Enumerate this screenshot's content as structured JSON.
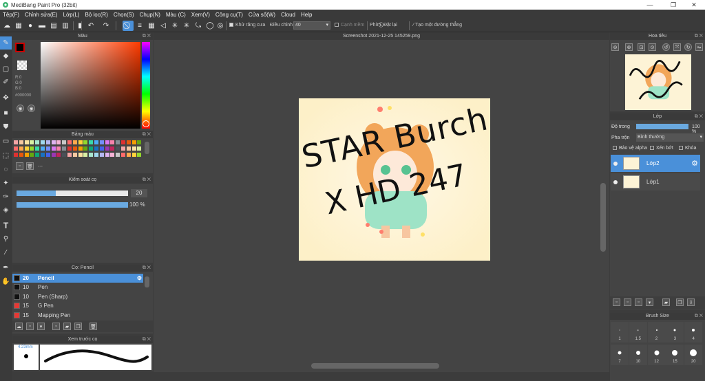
{
  "window": {
    "title": "MediBang Paint Pro (32bit)",
    "minimize": "—",
    "restore": "❐",
    "close": "✕"
  },
  "menu": [
    "Tệp(F)",
    "Chỉnh sửa(E)",
    "Lớp(L)",
    "Bộ lọc(R)",
    "Chọn(S)",
    "Chụp(N)",
    "Màu (C)",
    "Xem(V)",
    "Công cụ(T)",
    "Cửa sổ(W)",
    "Cloud",
    "Help"
  ],
  "toolbar": {
    "antialias_label": "Khử răng cưa",
    "adjust_label": "Điều chỉnh",
    "adjust_value": "40",
    "edge_label": "Cạnh mềm",
    "key_label": "Phím",
    "reset_label": "Đặt lại",
    "straight_line_label": "Tạo một đường thẳng"
  },
  "document": {
    "tab_title": "Screenshot 2021-12-25 145259.png",
    "artwork_text_1": "STAR Burch",
    "artwork_text_2": "X HD 247"
  },
  "color_panel": {
    "title": "Màu",
    "r_label": "R:0",
    "g_label": "G:0",
    "b_label": "B:0",
    "hex": "#000000",
    "primary_color": "#000000",
    "secondary_color": "#ff0000"
  },
  "palette_panel": {
    "title": "Bảng màu",
    "add_label": "---"
  },
  "brush_control_panel": {
    "title": "Kiểm soát cọ",
    "size_value": "20",
    "size_fraction": 0.35,
    "opacity_value": "100 %",
    "opacity_fraction": 1.0
  },
  "brush_panel": {
    "title": "Cọ: Pencil",
    "brushes": [
      {
        "size": "20",
        "name": "Pencil",
        "color": "#111111",
        "selected": true
      },
      {
        "size": "10",
        "name": "Pen",
        "color": "#111111",
        "selected": false
      },
      {
        "size": "10",
        "name": "Pen (Sharp)",
        "color": "#111111",
        "selected": false
      },
      {
        "size": "15",
        "name": "G Pen",
        "color": "#e53935",
        "selected": false
      },
      {
        "size": "15",
        "name": "Mapping Pen",
        "color": "#e53935",
        "selected": false
      }
    ]
  },
  "brush_preview_panel": {
    "title": "Xem trước cọ",
    "size_label": "4.23mm"
  },
  "navigator_panel": {
    "title": "Hoa tiêu"
  },
  "layer_panel": {
    "title": "Lớp",
    "opacity_label": "Độ trong",
    "opacity_value": "100 %",
    "opacity_fraction": 1.0,
    "blend_label": "Pha trộn",
    "blend_value": "Bình thường",
    "protect_alpha_label": "Bảo vệ alpha",
    "clipping_label": "Xén bớt",
    "lock_label": "Khóa",
    "layers": [
      {
        "name": "Lớp2",
        "selected": true
      },
      {
        "name": "Lớp1",
        "selected": false
      }
    ]
  },
  "brush_size_panel": {
    "title": "Brush Size",
    "sizes": [
      "1",
      "1.5",
      "2",
      "3",
      "4",
      "7",
      "10",
      "12",
      "15",
      "20"
    ]
  }
}
